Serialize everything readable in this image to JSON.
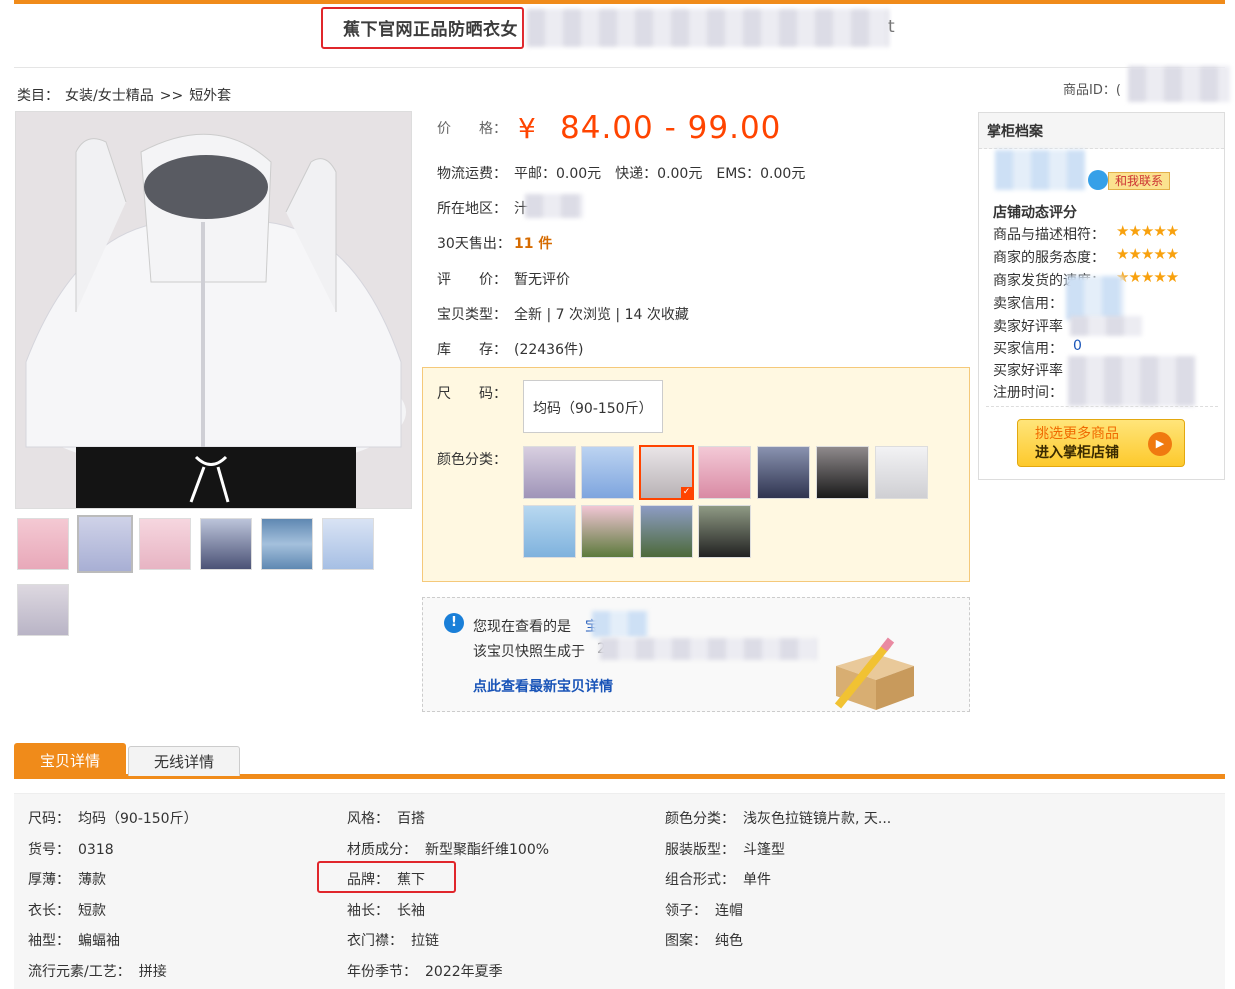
{
  "header": {
    "title": "蕉下官网正品防晒衣女",
    "title_suffix": "t"
  },
  "breadcrumb": {
    "prefix": "类目：",
    "level1": "女装/女士精品",
    "sep": ">>",
    "level2": "短外套"
  },
  "product_id_label": "商品ID：(",
  "product": {
    "price_label": "价　　格：",
    "currency": "¥",
    "price": "84.00 - 99.00",
    "shipping_label": "物流运费：",
    "shipping": "平邮：0.00元　快递：0.00元　EMS：0.00元",
    "location_label": "所在地区：",
    "location": "汁",
    "sold_label": "30天售出：",
    "sold": "11 件",
    "rating_label": "评　　价：",
    "rating": "暂无评价",
    "type_label": "宝贝类型：",
    "type": "全新 | 7 次浏览 | 14 次收藏",
    "stock_label": "库　　存：",
    "stock": "(22436件)"
  },
  "sku": {
    "size_label": "尺　　码：",
    "size_value": "均码（90-150斤）",
    "color_label": "颜色分类："
  },
  "snapshot": {
    "viewing": "您现在查看的是",
    "viewing_suffix": "宝",
    "generated": "该宝贝快照生成于",
    "generated_suffix": "2022",
    "latest_link": "点此查看最新宝贝详情"
  },
  "shop": {
    "title": "掌柜档案",
    "contact": "和我联系",
    "dynamic_score": "店铺动态评分",
    "score1_label": "商品与描述相符：",
    "score2_label": "商家的服务态度：",
    "score3_label": "商家发货的速度：",
    "stars": "★★★★★",
    "seller_credit_label": "卖家信用：",
    "seller_good_label": "卖家好评率",
    "buyer_credit_label": "买家信用：",
    "buyer_credit": "0",
    "buyer_good_label": "买家好评率",
    "register_label": "注册时间：",
    "more_line1": "挑选更多商品",
    "more_line2": "进入掌柜店铺"
  },
  "tabs": {
    "detail": "宝贝详情",
    "mobile": "无线详情"
  },
  "attributes": [
    {
      "k": "尺码：",
      "v": "均码（90-150斤）"
    },
    {
      "k": "风格：",
      "v": "百搭"
    },
    {
      "k": "颜色分类：",
      "v": "浅灰色拉链镜片款, 天..."
    },
    {
      "k": "货号：",
      "v": "0318"
    },
    {
      "k": "材质成分：",
      "v": "新型聚酯纤维100%"
    },
    {
      "k": "服装版型：",
      "v": "斗篷型"
    },
    {
      "k": "厚薄：",
      "v": "薄款"
    },
    {
      "k": "品牌：",
      "v": "蕉下"
    },
    {
      "k": "组合形式：",
      "v": "单件"
    },
    {
      "k": "衣长：",
      "v": "短款"
    },
    {
      "k": "袖长：",
      "v": "长袖"
    },
    {
      "k": "领子：",
      "v": "连帽"
    },
    {
      "k": "袖型：",
      "v": "蝙蝠袖"
    },
    {
      "k": "衣门襟：",
      "v": "拉链"
    },
    {
      "k": "图案：",
      "v": "纯色"
    },
    {
      "k": "流行元素/工艺：",
      "v": "拼接"
    },
    {
      "k": "年份季节：",
      "v": "2022年夏季"
    }
  ],
  "colors": {
    "price": "#ff4400",
    "accent": "#f08b1a",
    "link": "#1a55b8",
    "highlight_box": "#e0262b"
  }
}
